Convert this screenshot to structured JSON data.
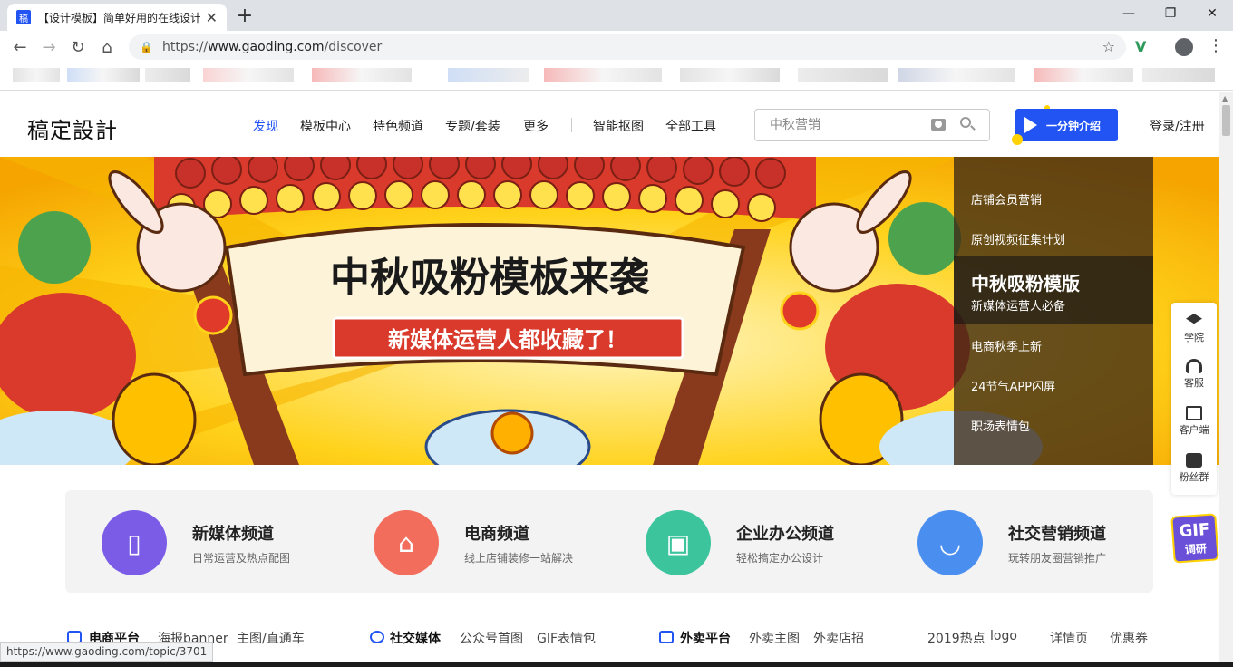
{
  "browser": {
    "tab_title": "【设计模板】简单好用的在线设计",
    "favicon_text": "稿",
    "url_prefix": "https://",
    "url_host": "www.gaoding.com",
    "url_path": "/discover",
    "status_url": "https://www.gaoding.com/topic/3701"
  },
  "header": {
    "logo": "稿定設計",
    "nav": [
      {
        "label": "发现",
        "active": true
      },
      {
        "label": "模板中心"
      },
      {
        "label": "特色频道"
      },
      {
        "label": "专题/套装"
      },
      {
        "label": "更多"
      },
      {
        "label": "智能抠图"
      },
      {
        "label": "全部工具"
      }
    ],
    "search_placeholder": "中秋营销",
    "intro_button": "一分钟介绍",
    "login": "登录/注册"
  },
  "banner": {
    "headline": "中秋吸粉模板来袭",
    "ribbon": "新媒体运营人都收藏了！",
    "menu": [
      "店铺会员营销",
      "原创视频征集计划",
      "中秋吸粉模版",
      "新媒体运营人必备",
      "电商秋季上新",
      "24节气APP闪屏",
      "职场表情包"
    ]
  },
  "float_bar": [
    "学院",
    "客服",
    "客户端",
    "粉丝群"
  ],
  "gif_badge": {
    "top": "GIF",
    "bottom": "调研"
  },
  "channels": [
    {
      "title": "新媒体频道",
      "sub": "日常运营及热点配图",
      "color": "#7b5ce6"
    },
    {
      "title": "电商频道",
      "sub": "线上店铺装修一站解决",
      "color": "#f26d5b"
    },
    {
      "title": "企业办公频道",
      "sub": "轻松搞定办公设计",
      "color": "#3cc49c"
    },
    {
      "title": "社交营销频道",
      "sub": "玩转朋友圈营销推广",
      "color": "#4a8ff0"
    }
  ],
  "categories": {
    "group1": {
      "head": "电商平台",
      "items": [
        "海报banner",
        "主图/直通车"
      ]
    },
    "group2": {
      "head": "社交媒体",
      "items": [
        "公众号首图",
        "GIF表情包"
      ]
    },
    "group3": {
      "head": "外卖平台",
      "items": [
        "外卖主图",
        "外卖店招"
      ]
    },
    "group4": {
      "items": [
        "2019热点",
        "logo",
        "详情页",
        "优惠券"
      ]
    }
  },
  "colors": {
    "brand": "#2254f4",
    "banner_bg": "#ffcb05"
  }
}
